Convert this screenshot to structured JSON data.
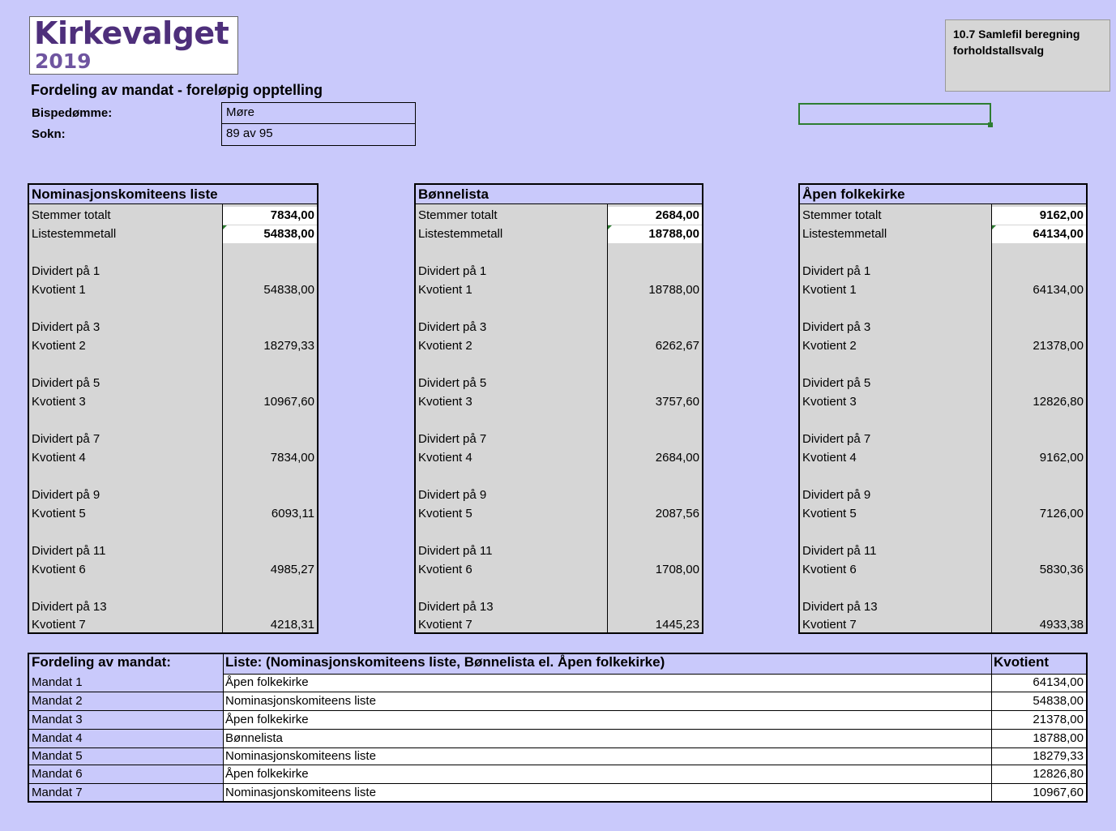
{
  "header": {
    "logo_title": "Kirkevalget",
    "logo_year": "2019",
    "subtitle": "Fordeling av mandat - foreløpig opptelling",
    "bispedomme_label": "Bispedømme:",
    "bispedomme_value": "Møre",
    "sokn_label": "Sokn:",
    "sokn_value": "89 av 95",
    "note": "10.7 Samlefil beregning forholdstallsvalg"
  },
  "lists": [
    {
      "name": "Nominasjonskomiteens liste",
      "stemmer_label": "Stemmer totalt",
      "stemmer": "7834,00",
      "listestemmetall_label": "Listestemmetall",
      "listestemmetall": "54838,00",
      "quotients": [
        {
          "div": "Dividert på 1",
          "kv": "Kvotient 1",
          "val": "54838,00"
        },
        {
          "div": "Dividert på 3",
          "kv": "Kvotient 2",
          "val": "18279,33"
        },
        {
          "div": "Dividert på 5",
          "kv": "Kvotient 3",
          "val": "10967,60"
        },
        {
          "div": "Dividert på 7",
          "kv": "Kvotient 4",
          "val": "7834,00"
        },
        {
          "div": "Dividert på 9",
          "kv": "Kvotient 5",
          "val": "6093,11"
        },
        {
          "div": "Dividert på 11",
          "kv": "Kvotient 6",
          "val": "4985,27"
        },
        {
          "div": "Dividert på 13",
          "kv": "Kvotient 7",
          "val": "4218,31"
        }
      ]
    },
    {
      "name": "Bønnelista",
      "stemmer_label": "Stemmer totalt",
      "stemmer": "2684,00",
      "listestemmetall_label": "Listestemmetall",
      "listestemmetall": "18788,00",
      "quotients": [
        {
          "div": "Dividert på 1",
          "kv": "Kvotient 1",
          "val": "18788,00"
        },
        {
          "div": "Dividert på 3",
          "kv": "Kvotient 2",
          "val": "6262,67"
        },
        {
          "div": "Dividert på 5",
          "kv": "Kvotient 3",
          "val": "3757,60"
        },
        {
          "div": "Dividert på 7",
          "kv": "Kvotient 4",
          "val": "2684,00"
        },
        {
          "div": "Dividert på 9",
          "kv": "Kvotient 5",
          "val": "2087,56"
        },
        {
          "div": "Dividert på 11",
          "kv": "Kvotient 6",
          "val": "1708,00"
        },
        {
          "div": "Dividert på 13",
          "kv": "Kvotient 7",
          "val": "1445,23"
        }
      ]
    },
    {
      "name": "Åpen folkekirke",
      "stemmer_label": "Stemmer totalt",
      "stemmer": "9162,00",
      "listestemmetall_label": "Listestemmetall",
      "listestemmetall": "64134,00",
      "quotients": [
        {
          "div": "Dividert på 1",
          "kv": "Kvotient 1",
          "val": "64134,00"
        },
        {
          "div": "Dividert på 3",
          "kv": "Kvotient 2",
          "val": "21378,00"
        },
        {
          "div": "Dividert på 5",
          "kv": "Kvotient 3",
          "val": "12826,80"
        },
        {
          "div": "Dividert på 7",
          "kv": "Kvotient 4",
          "val": "9162,00"
        },
        {
          "div": "Dividert på 9",
          "kv": "Kvotient 5",
          "val": "7126,00"
        },
        {
          "div": "Dividert på 11",
          "kv": "Kvotient 6",
          "val": "5830,36"
        },
        {
          "div": "Dividert på 13",
          "kv": "Kvotient 7",
          "val": "4933,38"
        }
      ]
    }
  ],
  "results": {
    "headers": [
      "Fordeling av mandat:",
      "Liste: (Nominasjonskomiteens liste, Bønnelista el. Åpen folkekirke)",
      "Kvotient"
    ],
    "rows": [
      {
        "mandat": "Mandat 1",
        "liste": "Åpen folkekirke",
        "kvotient": "64134,00"
      },
      {
        "mandat": "Mandat 2",
        "liste": "Nominasjonskomiteens liste",
        "kvotient": "54838,00"
      },
      {
        "mandat": "Mandat 3",
        "liste": "Åpen folkekirke",
        "kvotient": "21378,00"
      },
      {
        "mandat": "Mandat 4",
        "liste": "Bønnelista",
        "kvotient": "18788,00"
      },
      {
        "mandat": "Mandat 5",
        "liste": "Nominasjonskomiteens liste",
        "kvotient": "18279,33"
      },
      {
        "mandat": "Mandat 6",
        "liste": "Åpen folkekirke",
        "kvotient": "12826,80"
      },
      {
        "mandat": "Mandat 7",
        "liste": "Nominasjonskomiteens liste",
        "kvotient": "10967,60"
      }
    ]
  },
  "colors": {
    "background": "#c9c9fb",
    "logo_purple": "#4e2f7b",
    "cell_grey": "#d6d6d6",
    "selection_green": "#2e7d32"
  }
}
